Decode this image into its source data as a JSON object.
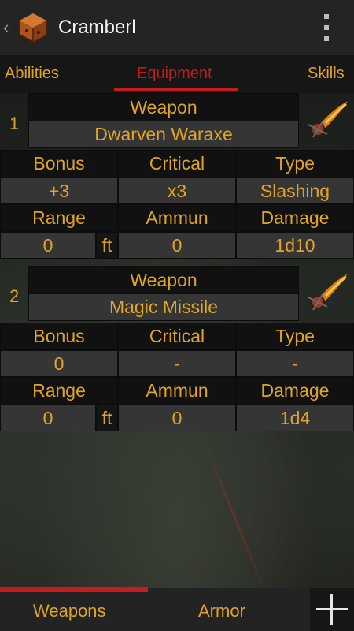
{
  "actionbar": {
    "title": "Cramberl",
    "back_glyph": "‹",
    "icon": "dice-icon",
    "overflow_icon": "overflow-menu-icon"
  },
  "tabs": [
    {
      "label": "Abilities",
      "active": false
    },
    {
      "label": "Equipment",
      "active": true
    },
    {
      "label": "Skills",
      "active": false
    }
  ],
  "weapons": [
    {
      "index": "1",
      "header_label": "Weapon",
      "name": "Dwarven Waraxe",
      "labels": {
        "bonus": "Bonus",
        "critical": "Critical",
        "type": "Type",
        "range": "Range",
        "ammun": "Ammun",
        "damage": "Damage"
      },
      "bonus": "+3",
      "critical": "x3",
      "type": "Slashing",
      "range": "0",
      "range_unit": "ft",
      "ammun": "0",
      "damage": "1d10"
    },
    {
      "index": "2",
      "header_label": "Weapon",
      "name": "Magic Missile",
      "labels": {
        "bonus": "Bonus",
        "critical": "Critical",
        "type": "Type",
        "range": "Range",
        "ammun": "Ammun",
        "damage": "Damage"
      },
      "bonus": "0",
      "critical": "-",
      "type": "-",
      "range": "0",
      "range_unit": "ft",
      "ammun": "0",
      "damage": "1d4"
    }
  ],
  "bottom_tabs": [
    {
      "label": "Weapons",
      "active": true
    },
    {
      "label": "Armor",
      "active": false
    }
  ],
  "add_button_icon": "plus-icon",
  "colors": {
    "accent_text": "#e0a526",
    "active_red": "#c41d1d",
    "cell_bg": "#353535"
  }
}
